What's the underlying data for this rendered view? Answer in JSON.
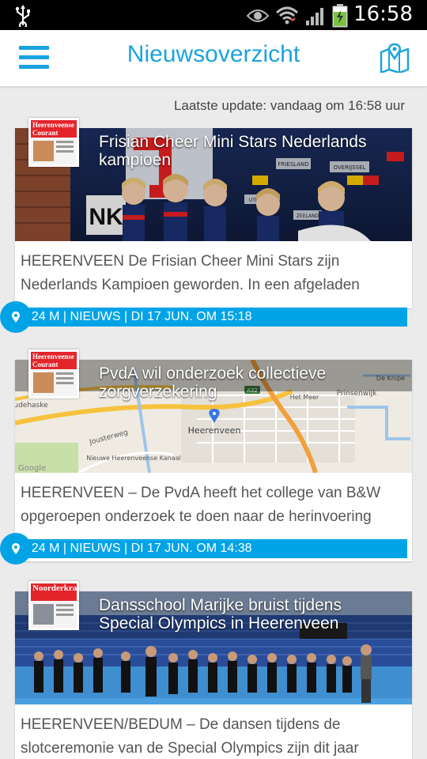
{
  "status_bar": {
    "time": "16:58",
    "icons": [
      "usb-icon",
      "eye-icon",
      "wifi-icon",
      "signal-icon",
      "battery-icon"
    ]
  },
  "app_bar": {
    "title": "Nieuwsoverzicht",
    "menu_icon": "hamburger-menu-icon",
    "map_icon": "map-icon"
  },
  "last_update": "Laatste update: vandaag om 16:58 uur",
  "colors": {
    "accent": "#00a4e6",
    "title": "#1aa3e0",
    "background": "#ebebeb"
  },
  "articles": [
    {
      "headline": "Frisian Cheer Mini Stars Nederlands kampioen",
      "snippet": "HEERENVEEN De Frisian Cheer Mini Stars zijn Nederlands Kampioen geworden. In een afgeladen",
      "meta": "624 M | NIEUWS | DI 17 JUN. OM 15:18",
      "source_masthead": "Heerenveense Courant",
      "image_signs": {
        "b1": "FRIESLAND",
        "b2": "OVERIJSSEL",
        "b3": "UTRECHT",
        "b4": "ZEELAND",
        "letters": "NK"
      }
    },
    {
      "headline": "PvdA wil onderzoek collectieve zorgverzekering",
      "snippet": "HEERENVEEN – De PvdA heeft het college van B&W opgeroepen onderzoek te doen naar de herinvoering",
      "meta": "624 M | NIEUWS | DI 17 JUN. OM 14:38",
      "source_masthead": "Heerenveense Courant",
      "map_labels": {
        "l1": "Heerenveen",
        "l2": "Jousterweg",
        "l3": "Nieuwe Heerenveense Kanaal",
        "l4": "Prinsenwijk",
        "l5": "Het Meer",
        "l6": "De Knipe",
        "l7": "A32",
        "l8": "udehaske",
        "l9": "Google"
      }
    },
    {
      "headline": "Dansschool Marijke bruist tijdens Special Olympics in Heerenveen",
      "snippet": "HEERENVEEN/BEDUM – De dansen tijdens de slotceremonie van de Special Olympics zijn dit jaar",
      "source_masthead": "Noorderkrant"
    }
  ]
}
